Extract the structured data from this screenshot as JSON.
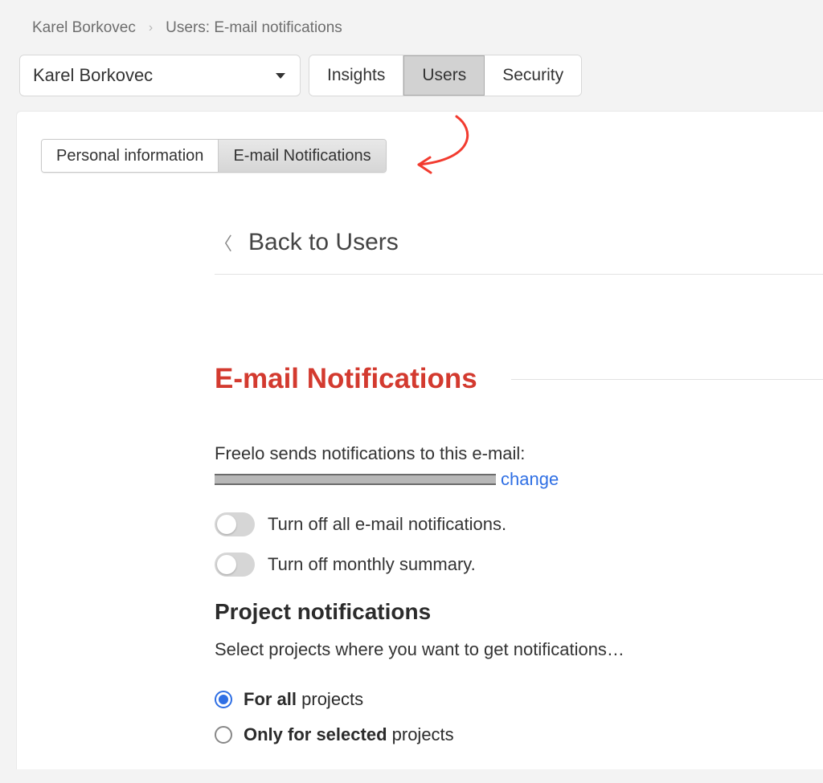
{
  "breadcrumb": {
    "item1": "Karel Borkovec",
    "item2": "Users: E-mail notifications"
  },
  "user_select": {
    "value": "Karel Borkovec"
  },
  "top_tabs": {
    "insights": "Insights",
    "users": "Users",
    "security": "Security"
  },
  "sub_tabs": {
    "personal": "Personal information",
    "email": "E-mail Notifications"
  },
  "back_link": "Back to Users",
  "page_title": "E-mail Notifications",
  "email_section": {
    "lead": "Freelo sends notifications to this e-mail:",
    "change_label": "change"
  },
  "toggles": {
    "all_off": "Turn off all e-mail notifications.",
    "monthly_off": "Turn off monthly summary."
  },
  "project_notifications": {
    "heading": "Project notifications",
    "lead": "Select projects where you want to get notifications…",
    "opt_all_bold": "For all",
    "opt_all_rest": " projects",
    "opt_selected_bold": "Only for selected",
    "opt_selected_rest": " projects"
  }
}
